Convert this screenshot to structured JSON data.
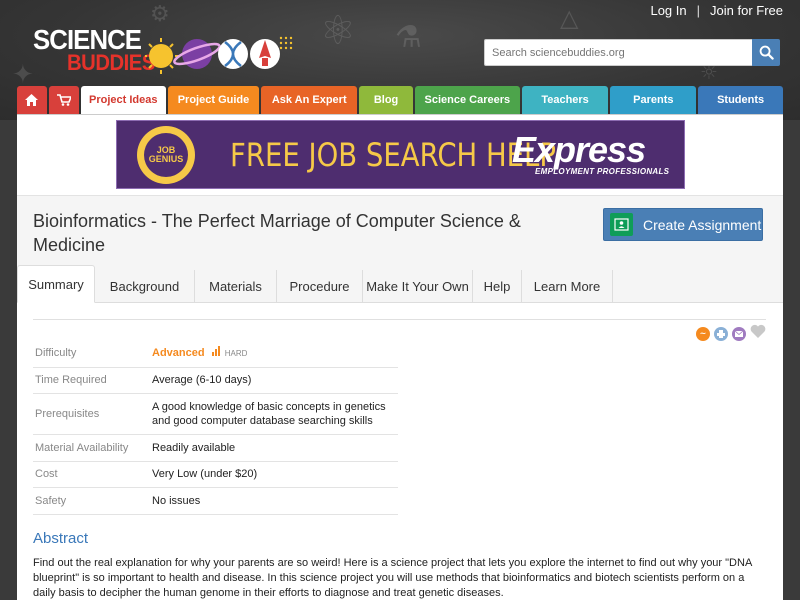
{
  "top_links": {
    "login": "Log In",
    "separator": "|",
    "join": "Join for Free"
  },
  "logo": {
    "line1": "SCIENCE",
    "line2": "BUDDIES"
  },
  "search": {
    "placeholder": "Search sciencebuddies.org",
    "icon": "search-icon"
  },
  "nav": {
    "home_icon": "home-icon",
    "cart_icon": "cart-icon",
    "tabs": [
      "Project Ideas",
      "Project Guide",
      "Ask An Expert",
      "Blog",
      "Science Careers",
      "Teachers",
      "Parents",
      "Students"
    ],
    "colors": [
      "#ffffff",
      "#f58a1f",
      "#e86426",
      "#8fb93b",
      "#4da44b",
      "#3eb3c2",
      "#2f9ec9",
      "#3a78b9"
    ]
  },
  "banner": {
    "badge_line1": "JOB",
    "badge_line2": "GENIUS",
    "slogan": "FREE JOB SEARCH HELP",
    "brand": "Express",
    "brand_sub": "EMPLOYMENT PROFESSIONALS",
    "background": "#4e2d6f",
    "accent": "#f6c948"
  },
  "page": {
    "title": "Bioinformatics - The Perfect Marriage of Computer Science & Medicine",
    "create_button": "Create Assignment",
    "classroom_icon": "google-classroom-icon"
  },
  "tabs": [
    "Summary",
    "Background",
    "Materials",
    "Procedure",
    "Make It Your Own",
    "Help",
    "Learn More"
  ],
  "active_tab": "Summary",
  "share_icons": [
    "rate-icon",
    "print-icon",
    "email-icon",
    "favorite-heart-icon"
  ],
  "facts": {
    "difficulty_label": "Difficulty",
    "difficulty_level": "Advanced",
    "difficulty_tag": "HARD",
    "difficulty_icon": "difficulty-bars-icon",
    "time_label": "Time Required",
    "time_value": "Average (6-10 days)",
    "prereq_label": "Prerequisites",
    "prereq_value": "A good knowledge of basic concepts in genetics and good computer database searching skills",
    "material_label": "Material Availability",
    "material_value": "Readily available",
    "cost_label": "Cost",
    "cost_value": "Very Low (under $20)",
    "safety_label": "Safety",
    "safety_value": "No issues"
  },
  "abstract": {
    "heading": "Abstract",
    "text": "Find out the real explanation for why your parents are so weird! Here is a science project that lets you explore the internet to find out why your \"DNA blueprint\" is so important to health and disease. In this science project you will use methods that bioinformatics and biotech scientists perform on a daily basis to decipher the human genome in their efforts to diagnose and treat genetic diseases."
  }
}
